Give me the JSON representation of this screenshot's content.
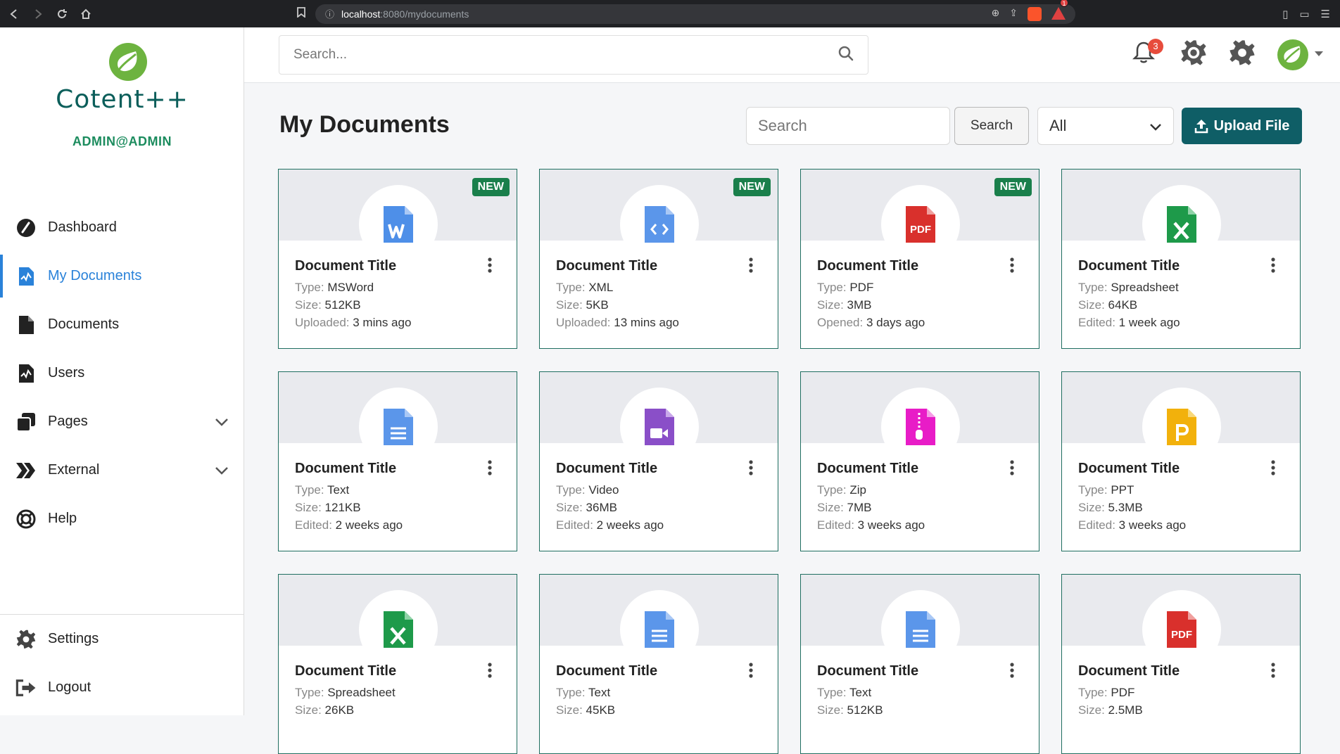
{
  "browser": {
    "url_host": "localhost",
    "url_path": ":8080/mydocuments"
  },
  "sidebar": {
    "brand": "Cotent++",
    "user": "ADMIN@ADMIN",
    "items": [
      {
        "label": "Dashboard",
        "icon": "gauge-icon"
      },
      {
        "label": "My Documents",
        "icon": "chart-file-icon",
        "active": true
      },
      {
        "label": "Documents",
        "icon": "file-icon"
      },
      {
        "label": "Users",
        "icon": "chart-file-icon"
      },
      {
        "label": "Pages",
        "icon": "copy-icon",
        "expandable": true
      },
      {
        "label": "External",
        "icon": "chevrons-icon",
        "expandable": true
      },
      {
        "label": "Help",
        "icon": "lifebuoy-icon"
      }
    ],
    "bottom_items": [
      {
        "label": "Settings",
        "icon": "gear-icon"
      },
      {
        "label": "Logout",
        "icon": "logout-icon"
      }
    ]
  },
  "topbar": {
    "search_placeholder": "Search...",
    "notification_count": "3"
  },
  "main": {
    "title": "My Documents",
    "filter_placeholder": "Search",
    "search_button": "Search",
    "type_filter": "All",
    "upload_button": "Upload File",
    "new_badge": "NEW",
    "labels": {
      "type": "Type:",
      "size": "Size:"
    }
  },
  "accent_colors": {
    "brand": "#0b5e5a",
    "active": "#2a82d9",
    "upload": "#0f5e66",
    "new_badge": "#1a7f4b"
  },
  "documents": [
    {
      "title": "Document Title",
      "type": "MSWord",
      "size": "512KB",
      "time_label": "Uploaded:",
      "time": "3 mins ago",
      "is_new": true,
      "icon": "word-icon",
      "color": "#4e8fe8"
    },
    {
      "title": "Document Title",
      "type": "XML",
      "size": "5KB",
      "time_label": "Uploaded:",
      "time": "13 mins ago",
      "is_new": true,
      "icon": "code-file-icon",
      "color": "#5b96ea"
    },
    {
      "title": "Document Title",
      "type": "PDF",
      "size": "3MB",
      "time_label": "Opened:",
      "time": "3 days ago",
      "is_new": true,
      "icon": "pdf-icon",
      "color": "#d9302c"
    },
    {
      "title": "Document Title",
      "type": "Spreadsheet",
      "size": "64KB",
      "time_label": "Edited:",
      "time": "1 week ago",
      "is_new": false,
      "icon": "excel-icon",
      "color": "#1e9a4a"
    },
    {
      "title": "Document Title",
      "type": "Text",
      "size": "121KB",
      "time_label": "Edited:",
      "time": "2 weeks ago",
      "is_new": false,
      "icon": "text-file-icon",
      "color": "#5b96ea"
    },
    {
      "title": "Document Title",
      "type": "Video",
      "size": "36MB",
      "time_label": "Edited:",
      "time": "2 weeks ago",
      "is_new": false,
      "icon": "video-file-icon",
      "color": "#8a4fc8"
    },
    {
      "title": "Document Title",
      "type": "Zip",
      "size": "7MB",
      "time_label": "Edited:",
      "time": "3 weeks ago",
      "is_new": false,
      "icon": "zip-file-icon",
      "color": "#e81cc7"
    },
    {
      "title": "Document Title",
      "type": "PPT",
      "size": "5.3MB",
      "time_label": "Edited:",
      "time": "3 weeks ago",
      "is_new": false,
      "icon": "ppt-icon",
      "color": "#f2b10c"
    },
    {
      "title": "Document Title",
      "type": "Spreadsheet",
      "size": "26KB",
      "time_label": "",
      "time": "",
      "is_new": false,
      "icon": "excel-icon",
      "color": "#1e9a4a"
    },
    {
      "title": "Document Title",
      "type": "Text",
      "size": "45KB",
      "time_label": "",
      "time": "",
      "is_new": false,
      "icon": "text-file-icon",
      "color": "#5b96ea"
    },
    {
      "title": "Document Title",
      "type": "Text",
      "size": "512KB",
      "time_label": "",
      "time": "",
      "is_new": false,
      "icon": "text-file-icon",
      "color": "#5b96ea"
    },
    {
      "title": "Document Title",
      "type": "PDF",
      "size": "2.5MB",
      "time_label": "",
      "time": "",
      "is_new": false,
      "icon": "pdf-icon",
      "color": "#d9302c"
    }
  ]
}
